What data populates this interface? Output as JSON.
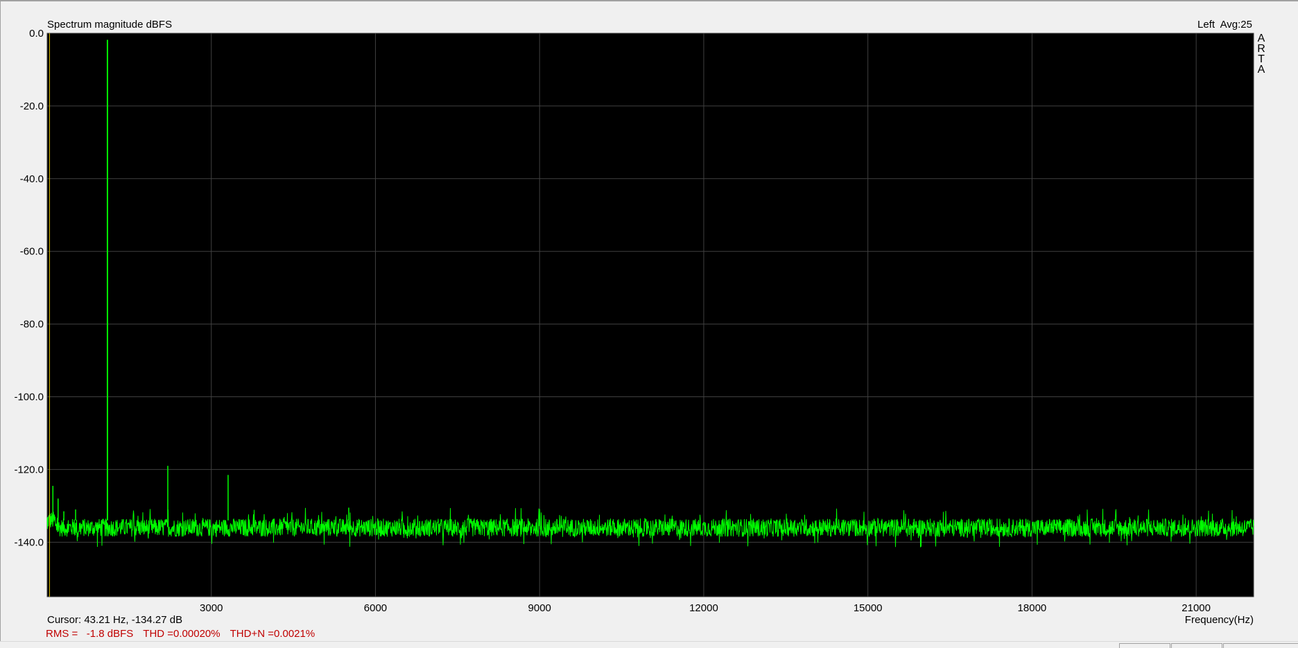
{
  "header": {
    "title": "Spectrum magnitude dBFS",
    "channel": "Left",
    "averaging": "Avg:25",
    "watermark": [
      "A",
      "R",
      "T",
      "A"
    ]
  },
  "footer": {
    "cursor": "Cursor: 43.21 Hz, -134.27 dB",
    "rms": "RMS =   -1.8 dBFS",
    "thd": "THD =0.00020%",
    "thdn": "THD+N =0.0021%"
  },
  "chart_data": {
    "type": "line",
    "title": "Spectrum magnitude dBFS",
    "xlabel": "Frequency(Hz)",
    "ylabel": "dBFS",
    "xlim": [
      0,
      22050
    ],
    "ylim": [
      -155,
      0
    ],
    "xticks": [
      3000,
      6000,
      9000,
      12000,
      15000,
      18000,
      21000
    ],
    "xtick_labels": [
      "3000",
      "6000",
      "9000",
      "12000",
      "15000",
      "18000",
      "21000"
    ],
    "yticks": [
      0,
      -20,
      -40,
      -60,
      -80,
      -100,
      -120,
      -140
    ],
    "ytick_labels": [
      "0.0",
      "-20.0",
      "-40.0",
      "-60.0",
      "-80.0",
      "-100.0",
      "-120.0",
      "-140.0"
    ],
    "grid": true,
    "cursor_hz": 43.21,
    "noise_floor_db": -136,
    "peaks": [
      {
        "name": "fundamental",
        "x": 1102,
        "y": -1.8
      },
      {
        "name": "harmonic-2",
        "x": 2205,
        "y": -119
      },
      {
        "name": "harmonic-3",
        "x": 3307,
        "y": -121.5
      },
      {
        "name": "harmonic-5",
        "x": 5512,
        "y": -130.5
      },
      {
        "name": "spur-100hz",
        "x": 105,
        "y": -124.5
      },
      {
        "name": "spur-200hz",
        "x": 200,
        "y": -128
      },
      {
        "name": "spur-300hz",
        "x": 305,
        "y": -131.5
      },
      {
        "name": "spur-500hz",
        "x": 520,
        "y": -131
      }
    ],
    "colors": {
      "trace": "#00ff00",
      "background": "#000000",
      "grid": "#404040",
      "cursor": "#e0c000"
    }
  }
}
